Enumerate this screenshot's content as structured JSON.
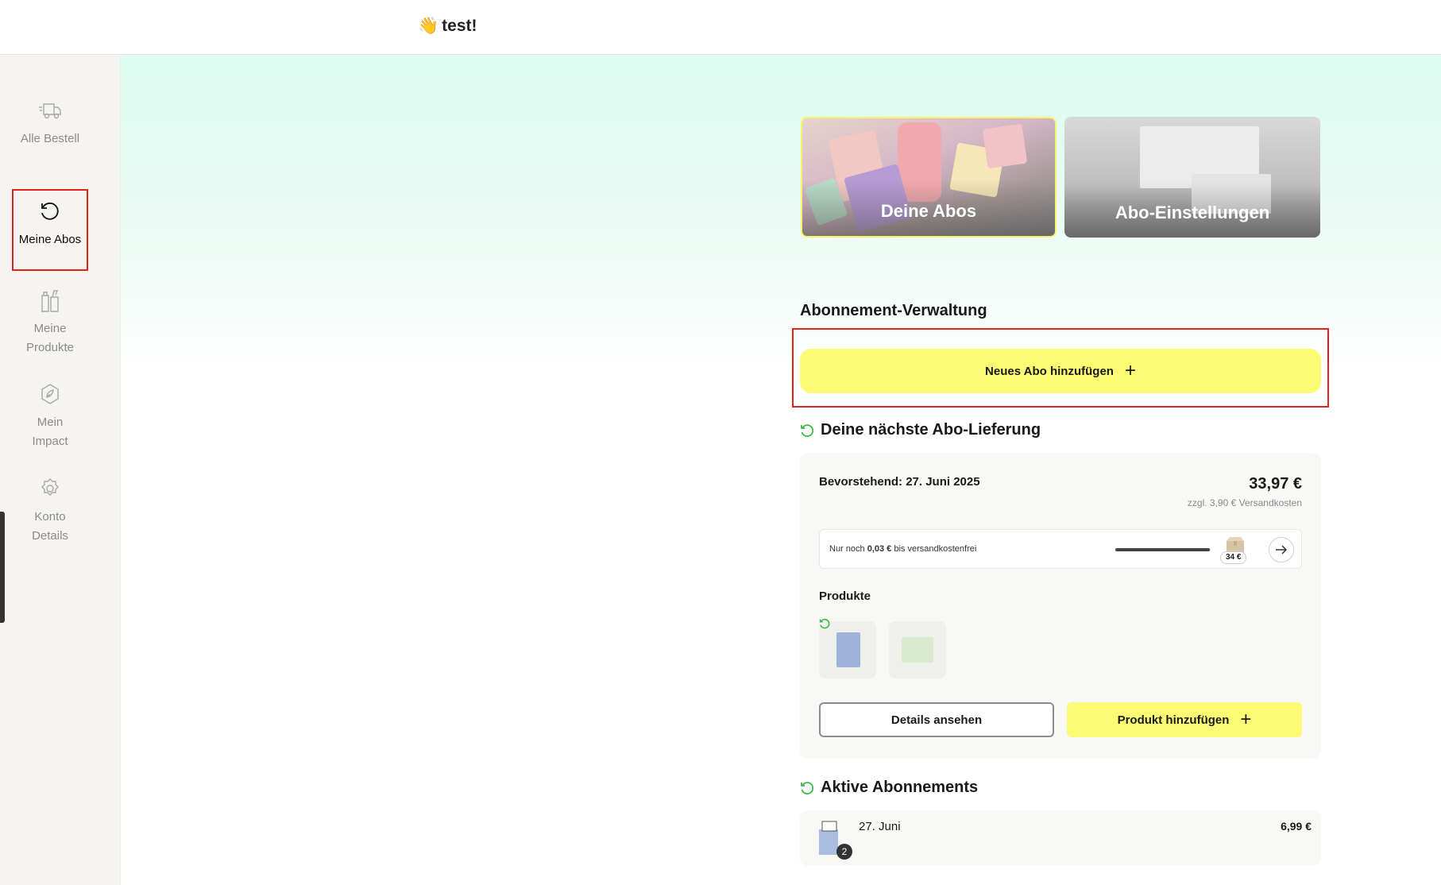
{
  "header": {
    "greeting_emoji": "👋",
    "greeting": "test!"
  },
  "sidebar": {
    "items": [
      {
        "label": "Alle Bestell",
        "icon": "truck-icon",
        "active": false
      },
      {
        "label": "Meine Abos",
        "icon": "refresh-icon",
        "active": true
      },
      {
        "label": "Meine Produkte",
        "icon": "bottles-icon",
        "active": false
      },
      {
        "label": "Mein Impact",
        "icon": "leaf-icon",
        "active": false
      },
      {
        "label": "Konto Details",
        "icon": "gear-icon",
        "active": false
      }
    ]
  },
  "tiles": {
    "abos_label": "Deine Abos",
    "settings_label": "Abo-Einstellungen"
  },
  "management": {
    "title": "Abonnement-Verwaltung",
    "new_abo_label": "Neues Abo hinzufügen"
  },
  "next_delivery": {
    "title": "Deine nächste Abo-Lieferung",
    "upcoming": "Bevorstehend: 27. Juni 2025",
    "price": "33,97 €",
    "shipping_note": "zzgl. 3,90 € Versandkosten",
    "free_shipping": {
      "prefix": "Nur noch ",
      "amount": "0,03 €",
      "suffix": " bis versandkostenfrei",
      "threshold": "34 €",
      "progress_percent": 99
    },
    "products_label": "Produkte",
    "details_label": "Details ansehen",
    "add_product_label": "Produkt hinzufügen"
  },
  "active_subscriptions": {
    "title": "Aktive Abonnements",
    "items": [
      {
        "date": "27. Juni",
        "price": "6,99 €",
        "quantity": "2"
      }
    ]
  },
  "colors": {
    "accent_yellow": "#fdfa74",
    "highlight_red": "#e2231a",
    "sub_green": "#3cb84a"
  }
}
